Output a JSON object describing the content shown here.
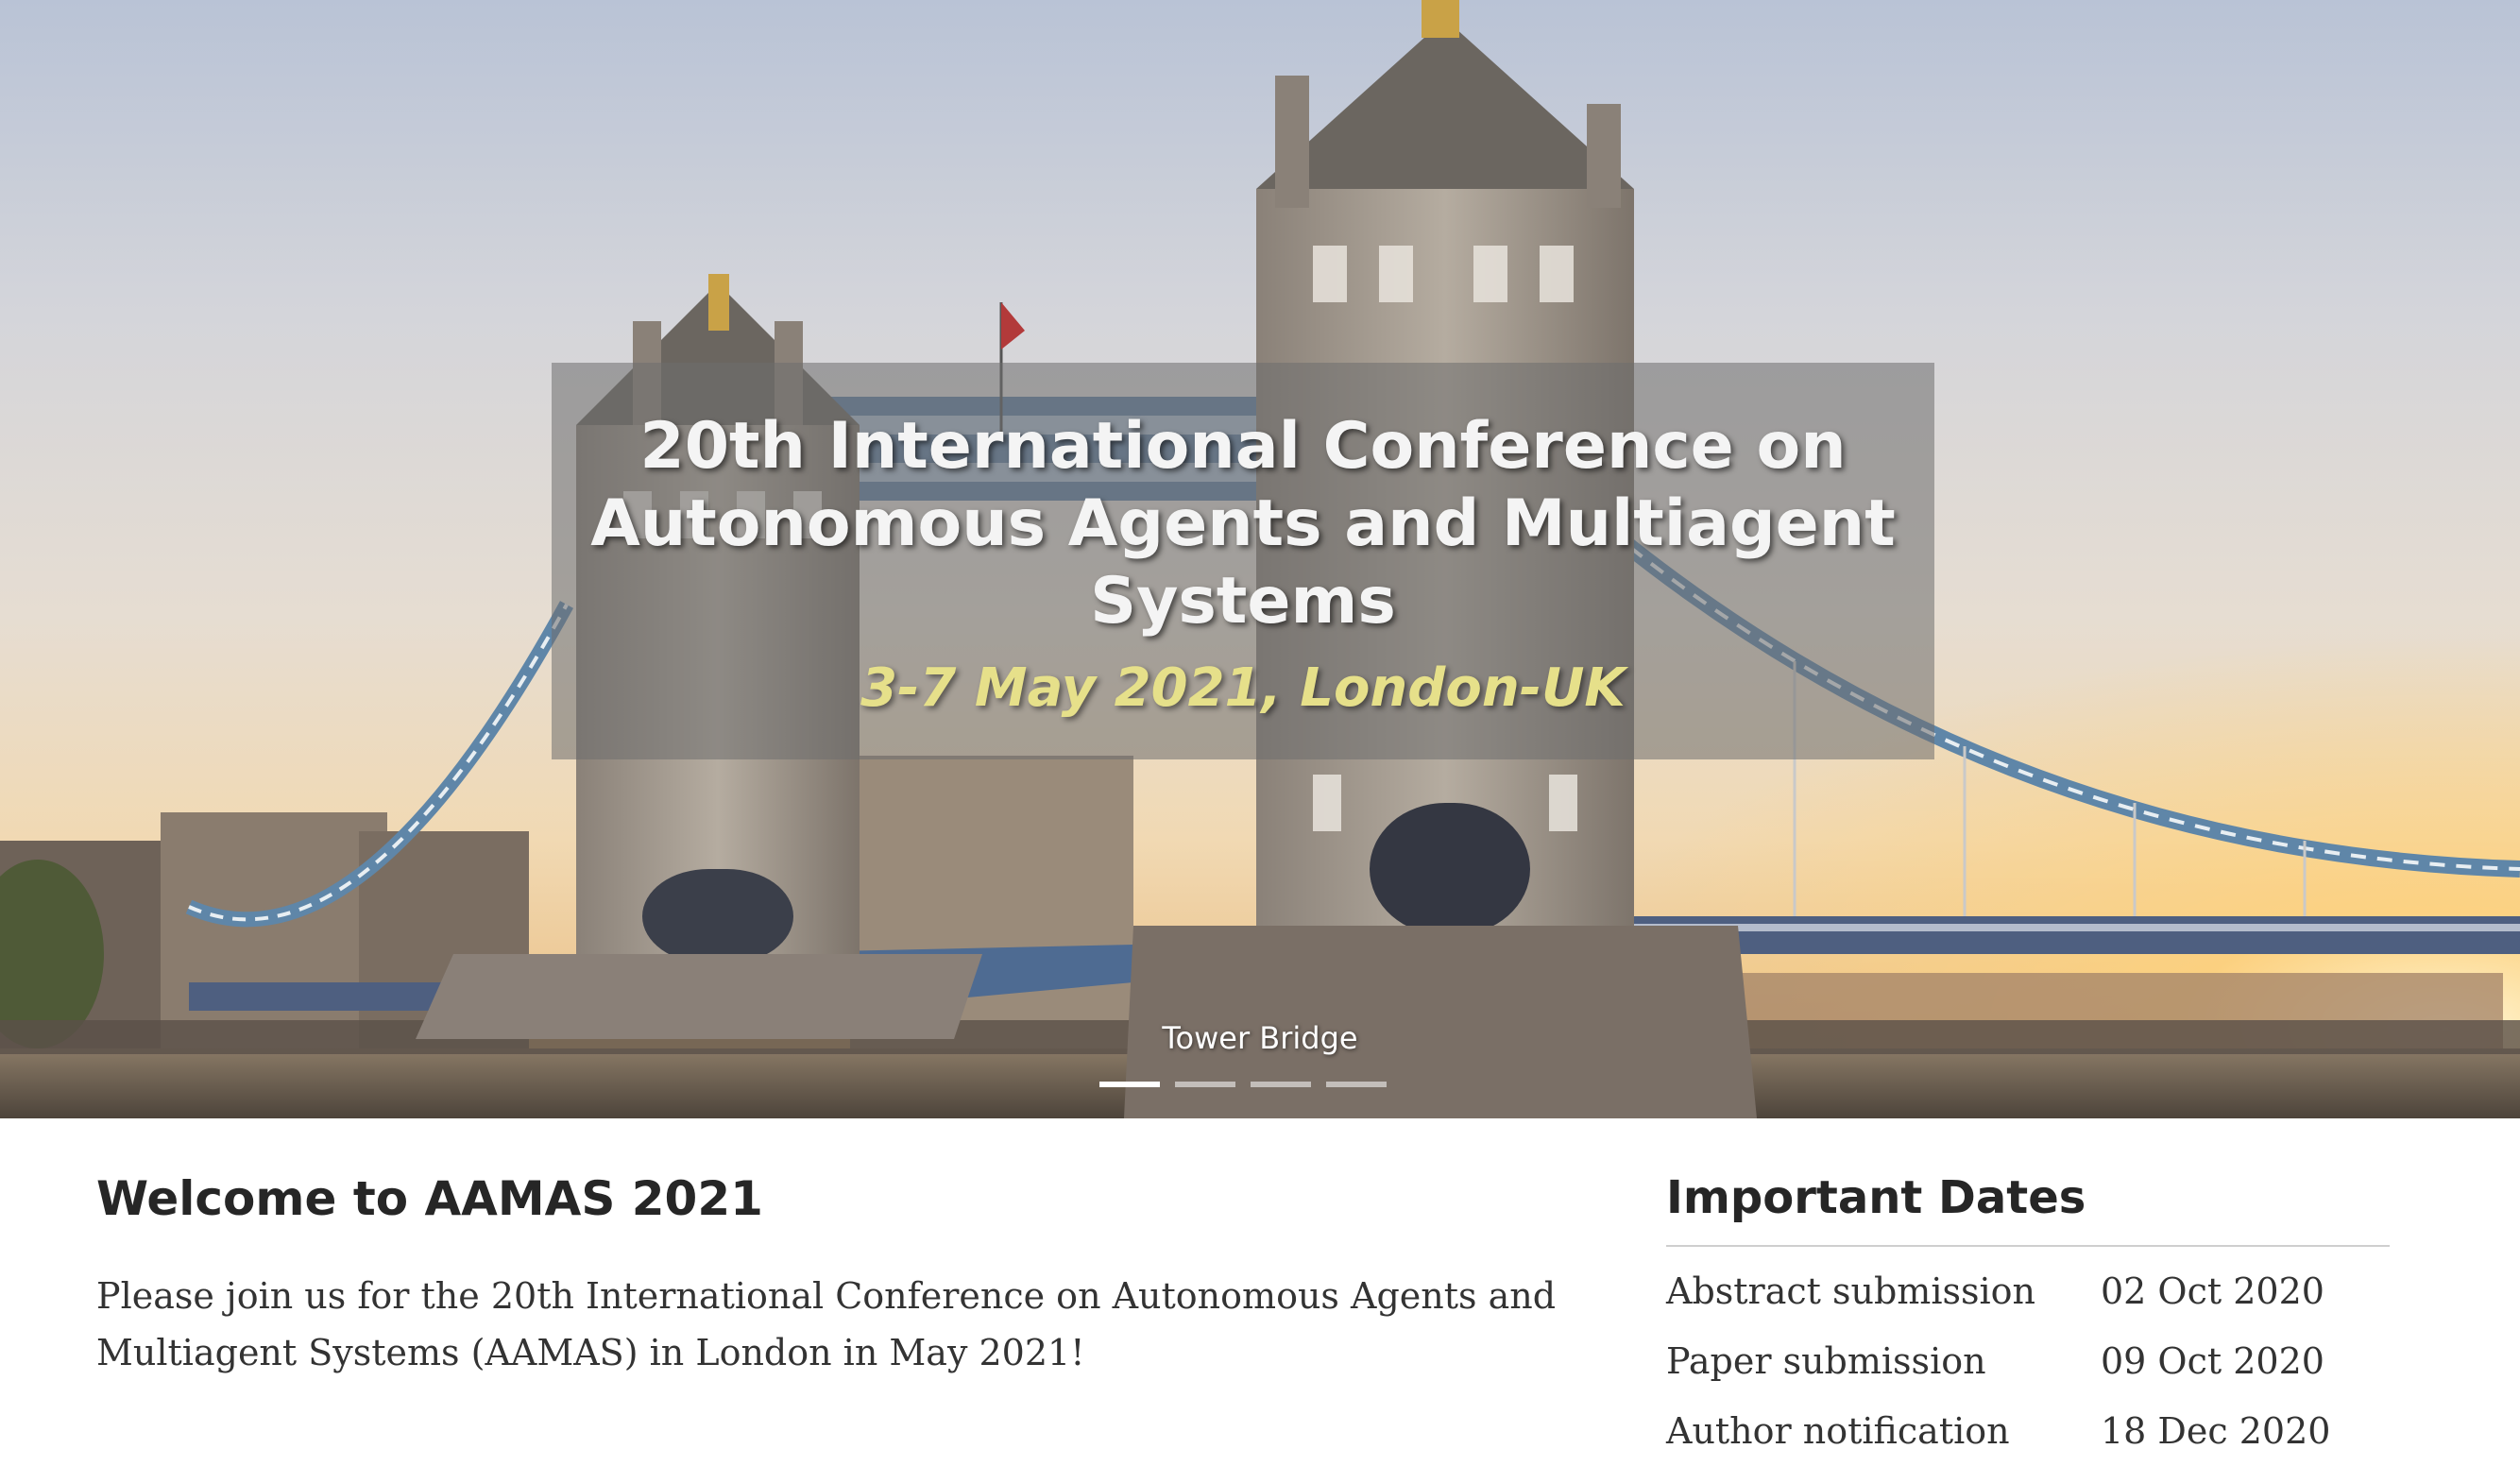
{
  "hero": {
    "title": "20th International Conference on Autonomous Agents and Multiagent Systems",
    "subtitle": "3-7 May 2021, London-UK",
    "caption": "Tower Bridge",
    "slides": 4,
    "active_slide": 1
  },
  "welcome": {
    "heading": "Welcome to AAMAS 2021",
    "text": "Please join us for the 20th International Conference on Autonomous Agents and Multiagent Systems (AAMAS) in London in May 2021!"
  },
  "important_dates": {
    "heading": "Important Dates",
    "rows": [
      {
        "label": "Abstract submission",
        "date": "02 Oct 2020"
      },
      {
        "label": "Paper submission",
        "date": "09 Oct 2020"
      },
      {
        "label": "Author notification",
        "date": "18 Dec 2020"
      }
    ]
  },
  "colors": {
    "subtitle": "#e6e08a",
    "heading": "#262626",
    "body_text": "#333333"
  }
}
